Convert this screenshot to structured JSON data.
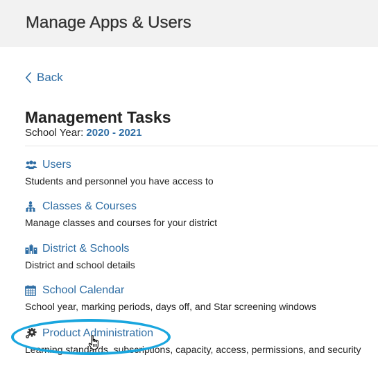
{
  "header": {
    "title": "Manage Apps & Users"
  },
  "nav": {
    "back_label": "Back"
  },
  "section": {
    "title": "Management Tasks",
    "year_label": "School Year:",
    "year_value": "2020 - 2021"
  },
  "tasks": [
    {
      "icon": "users-icon",
      "label": "Users",
      "description": "Students and personnel you have access to"
    },
    {
      "icon": "org-chart-icon",
      "label": "Classes & Courses",
      "description": "Manage classes and courses for your district"
    },
    {
      "icon": "buildings-icon",
      "label": "District & Schools",
      "description": "District and school details"
    },
    {
      "icon": "calendar-icon",
      "label": "School Calendar",
      "description": "School year, marking periods, days off, and Star screening windows"
    },
    {
      "icon": "gears-icon",
      "label": "Product Administration",
      "description": "Learning standards, subscriptions, capacity, access, permissions, and security"
    }
  ],
  "colors": {
    "link": "#2e6da4",
    "highlight": "#1aa6de",
    "header_bg": "#f2f2f2"
  }
}
